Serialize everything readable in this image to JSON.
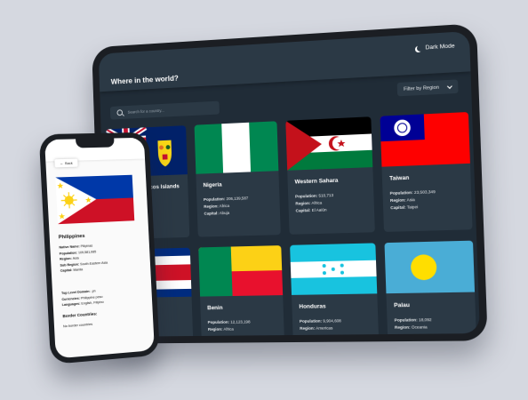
{
  "app": {
    "title": "Where in the world?",
    "dark_mode_label": "Dark Mode",
    "search_placeholder": "Search for a country...",
    "filter_label": "Filter by Region"
  },
  "cards": [
    {
      "name": "Turks and Caicos Islands",
      "short_name": "Turks and Caicos Islands",
      "population": "",
      "region": "",
      "capital": ""
    },
    {
      "name": "Nigeria",
      "population": "206,139,587",
      "region": "Africa",
      "capital": "Abuja"
    },
    {
      "name": "Western Sahara",
      "population": "510,713",
      "region": "Africa",
      "capital": "El Aaiún"
    },
    {
      "name": "Taiwan",
      "population": "23,503,349",
      "region": "Asia",
      "capital": "Taipei"
    },
    {
      "name": "Benin",
      "population": "12,123,198",
      "region": "Africa",
      "capital": ""
    },
    {
      "name": "Honduras",
      "population": "9,904,608",
      "region": "Americas",
      "capital": ""
    },
    {
      "name": "Palau",
      "population": "18,092",
      "region": "Oceania",
      "capital": ""
    }
  ],
  "labels": {
    "population": "Population:",
    "region": "Region:",
    "capital": "Capital:"
  },
  "phone": {
    "back_label": "Back",
    "country_name": "Philippines",
    "details": [
      {
        "label": "Native Name:",
        "value": "Pilipinas"
      },
      {
        "label": "Population:",
        "value": "109,581,085"
      },
      {
        "label": "Region:",
        "value": "Asia"
      },
      {
        "label": "Sub Region:",
        "value": "South-Eastern Asia"
      },
      {
        "label": "Capital:",
        "value": "Manila"
      }
    ],
    "details2": [
      {
        "label": "Top Level Domain:",
        "value": ".ph"
      },
      {
        "label": "Currencies:",
        "value": "Philippine peso"
      },
      {
        "label": "Languages:",
        "value": "English, Filipino"
      }
    ],
    "border_title": "Border Countries:",
    "border_value": "No border countries"
  },
  "colors": {
    "bg": "#d5d8e0",
    "dark_bg": "#202c37",
    "dark_elem": "#2b3945",
    "device": "#1b1e23"
  }
}
